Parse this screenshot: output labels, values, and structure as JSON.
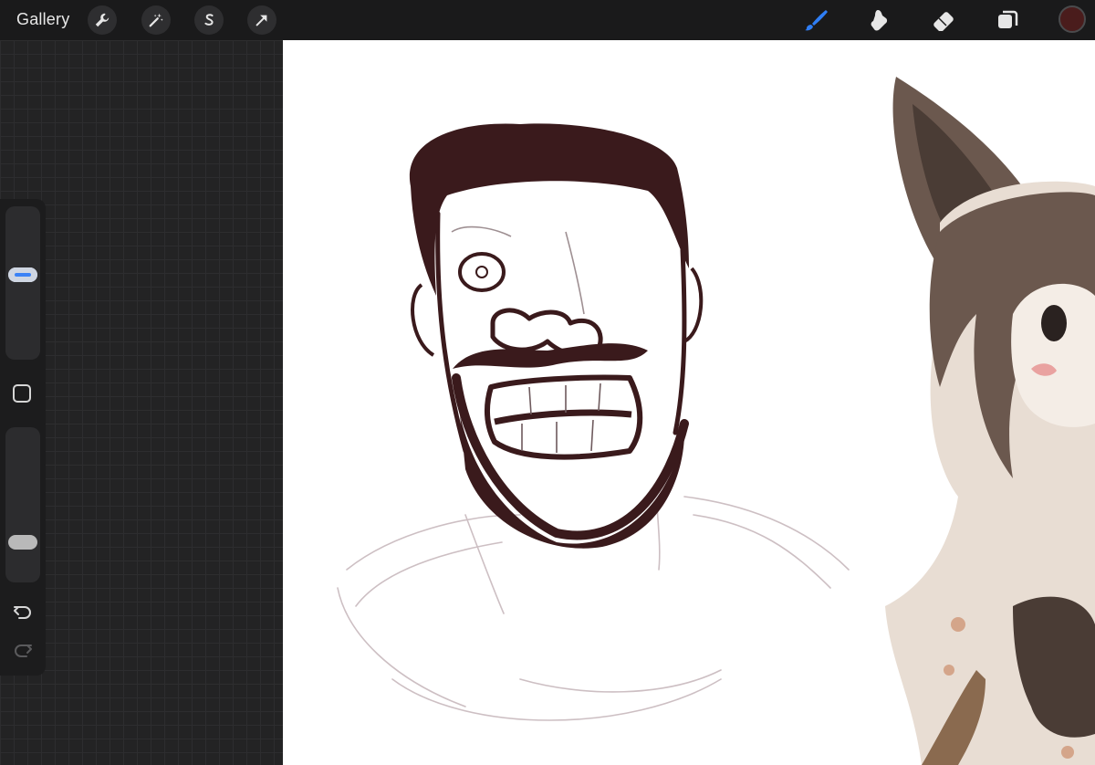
{
  "app": {
    "gallery_label": "Gallery"
  },
  "top_left_tools": [
    {
      "name": "actions-wrench-icon"
    },
    {
      "name": "adjustments-wand-icon"
    },
    {
      "name": "selection-s-icon"
    },
    {
      "name": "transform-arrow-icon"
    }
  ],
  "top_right_tools": [
    {
      "name": "brush-icon",
      "active": true,
      "color": "#2f7ef5"
    },
    {
      "name": "smudge-icon",
      "active": false,
      "color": "#e6e6e6"
    },
    {
      "name": "eraser-icon",
      "active": false,
      "color": "#e6e6e6"
    },
    {
      "name": "layers-icon",
      "active": false,
      "color": "#e6e6e6"
    }
  ],
  "current_color": "#4a1c1c",
  "sidebar": {
    "brush_size_level": 0.56,
    "opacity_level": 0.22,
    "size_thumb_color": "#3b82f6",
    "opacity_thumb_color": "#b9b9b9",
    "modify_button": "square-modify-icon",
    "undo_icon": "undo-icon",
    "redo_icon": "redo-icon"
  },
  "canvas": {
    "background": "#ffffff",
    "ink_color": "#3a1a1c",
    "sketch_color": "#c8b9bd"
  }
}
